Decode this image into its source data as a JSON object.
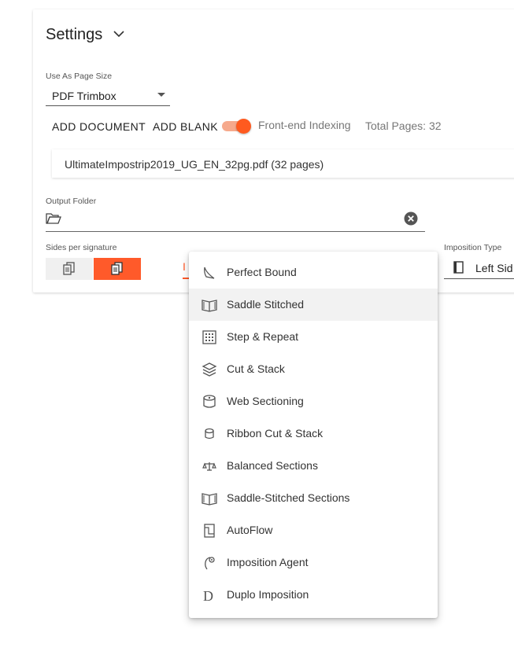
{
  "header": {
    "title": "Settings"
  },
  "page_size": {
    "label": "Use As Page Size",
    "value": "PDF Trimbox"
  },
  "actions": {
    "add_document": "ADD DOCUMENT",
    "add_blank": "ADD BLANK"
  },
  "indexing": {
    "label": "Front-end Indexing",
    "enabled": true
  },
  "total_pages": "Total Pages: 32",
  "document": {
    "file": "UltimateImpostrip2019_UG_EN_32pg.pdf (32 pages)"
  },
  "output_folder": {
    "label": "Output Folder",
    "value": ""
  },
  "sides": {
    "label": "Sides per signature"
  },
  "hidden_field_stub": "I",
  "imposition_type": {
    "label": "Imposition Type",
    "value": "Left Sid"
  },
  "menu": {
    "items": [
      {
        "label": "Perfect Bound",
        "icon": "perfect-bound-icon"
      },
      {
        "label": "Saddle Stitched",
        "icon": "saddle-stitched-icon",
        "selected": true
      },
      {
        "label": "Step & Repeat",
        "icon": "step-repeat-icon"
      },
      {
        "label": "Cut & Stack",
        "icon": "cut-stack-icon"
      },
      {
        "label": "Web Sectioning",
        "icon": "web-sectioning-icon"
      },
      {
        "label": "Ribbon Cut & Stack",
        "icon": "ribbon-cut-stack-icon"
      },
      {
        "label": "Balanced Sections",
        "icon": "balanced-sections-icon"
      },
      {
        "label": "Saddle-Stitched Sections",
        "icon": "saddle-stitched-sections-icon"
      },
      {
        "label": "AutoFlow",
        "icon": "autoflow-icon"
      },
      {
        "label": "Imposition Agent",
        "icon": "imposition-agent-icon"
      },
      {
        "label": "Duplo Imposition",
        "icon": "duplo-imposition-icon"
      }
    ]
  },
  "colors": {
    "accent": "#ff5a2a",
    "accent_light": "#f6a98c"
  }
}
